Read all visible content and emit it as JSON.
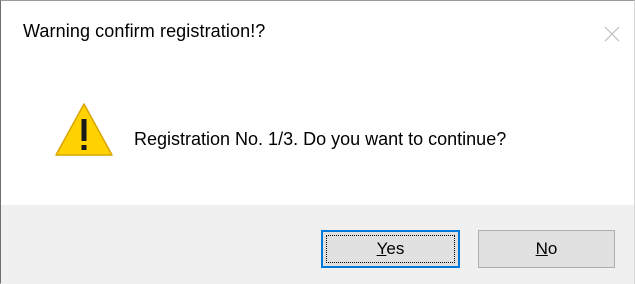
{
  "dialog": {
    "title": "Warning confirm registration!?",
    "icon": "warning-icon",
    "message": "Registration No. 1/3. Do you want to continue?",
    "buttons": {
      "yes": {
        "mnemonic": "Y",
        "rest": "es"
      },
      "no": {
        "mnemonic": "N",
        "rest": "o"
      }
    }
  },
  "colors": {
    "warning_fill": "#ffd200",
    "focus_border": "#0078d7",
    "footer_bg": "#f0f0f0",
    "button_bg": "#e1e1e1"
  }
}
